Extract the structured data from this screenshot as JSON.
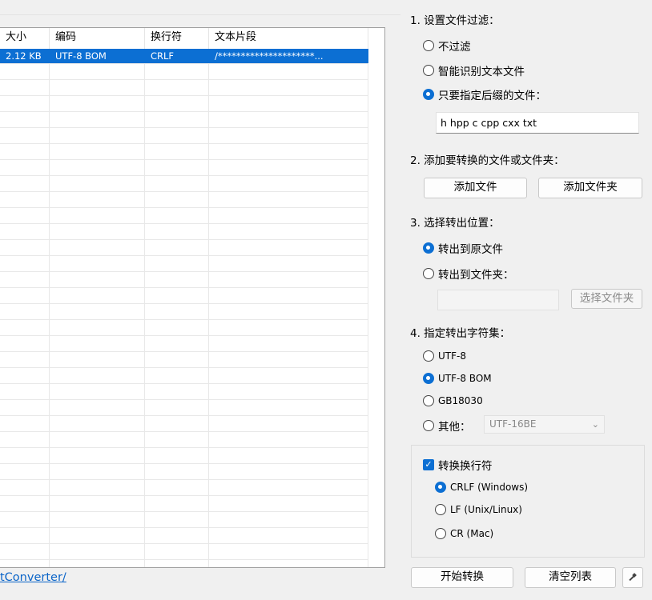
{
  "list": {
    "headers": [
      "大小",
      "编码",
      "换行符",
      "文本片段"
    ],
    "rows": [
      [
        "2.12 KB",
        "UTF-8 BOM",
        "CRLF",
        "/*********************..."
      ]
    ]
  },
  "footer_link": "tConverter/",
  "filter": {
    "title": "1. 设置文件过滤：",
    "options": [
      "不过滤",
      "智能识别文本文件",
      "只要指定后缀的文件："
    ],
    "selected": 2,
    "suffix_value": "h hpp c cpp cxx txt"
  },
  "add": {
    "title": "2. 添加要转换的文件或文件夹：",
    "add_file_label": "添加文件",
    "add_folder_label": "添加文件夹"
  },
  "output": {
    "title": "3. 选择转出位置：",
    "options": [
      "转出到原文件",
      "转出到文件夹："
    ],
    "selected": 0,
    "folder_value": "",
    "choose_folder_label": "选择文件夹"
  },
  "charset": {
    "title": "4. 指定转出字符集：",
    "options": [
      "UTF-8",
      "UTF-8 BOM",
      "GB18030",
      "其他："
    ],
    "selected": 1,
    "other_value": "UTF-16BE"
  },
  "newline": {
    "checkbox_label": "转换换行符",
    "checked": true,
    "options": [
      "CRLF (Windows)",
      "LF (Unix/Linux)",
      "CR (Mac)"
    ],
    "selected": 0
  },
  "actions": {
    "start_label": "开始转换",
    "clear_label": "清空列表",
    "tool_icon": "hammer-icon"
  },
  "colors": {
    "accent": "#0c6fd3",
    "selection": "#0c6fd3",
    "link": "#0a64c8"
  }
}
